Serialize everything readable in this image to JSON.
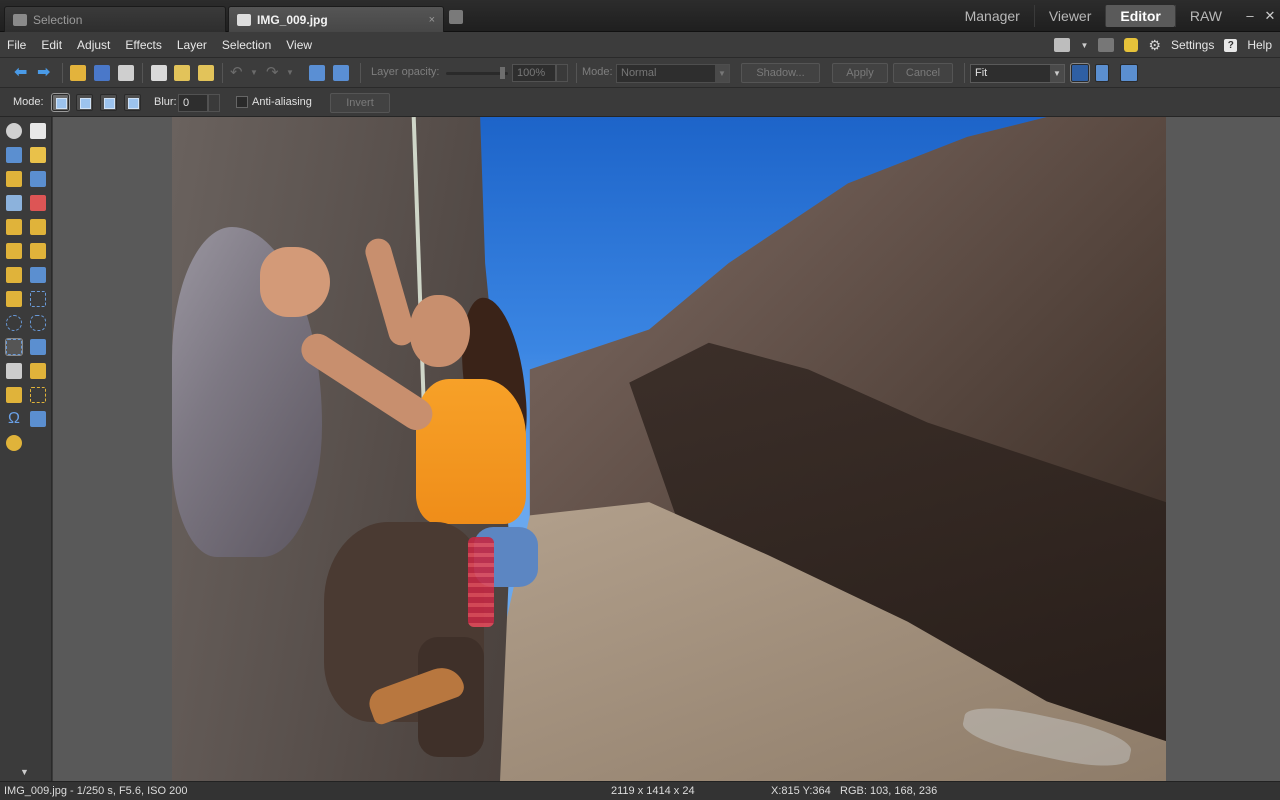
{
  "tabs": [
    {
      "label": "Selection",
      "icon": "folder-icon",
      "active": false
    },
    {
      "label": "IMG_009.jpg",
      "icon": "edit-icon",
      "active": true,
      "close": "×"
    }
  ],
  "modes": [
    {
      "label": "Manager",
      "active": false
    },
    {
      "label": "Viewer",
      "active": false
    },
    {
      "label": "Editor",
      "active": true
    },
    {
      "label": "RAW",
      "active": false
    }
  ],
  "window": {
    "minimize": "–",
    "close": "✕"
  },
  "menu": [
    {
      "label": "File",
      "key": "F"
    },
    {
      "label": "Edit",
      "key": "E"
    },
    {
      "label": "Adjust",
      "key": "A"
    },
    {
      "label": "Effects",
      "key": "E"
    },
    {
      "label": "Layer",
      "key": "L"
    },
    {
      "label": "Selection",
      "key": "S"
    },
    {
      "label": "View",
      "key": "V"
    }
  ],
  "menu_right": {
    "settings": "Settings",
    "help": "Help"
  },
  "toolbar": {
    "layer_opacity_label": "Layer opacity:",
    "layer_opacity_value": "100%",
    "mode_label": "Mode:",
    "mode_value": "Normal",
    "shadow_button": "Shadow...",
    "apply_button": "Apply",
    "cancel_button": "Cancel",
    "zoom_value": "Fit"
  },
  "selection_bar": {
    "mode_label": "Mode:",
    "blur_label": "Blur:",
    "blur_value": "0",
    "antialias_label": "Anti-aliasing",
    "invert_button": "Invert"
  },
  "status": {
    "file_info": "IMG_009.jpg - 1/250 s, F5.6, ISO 200",
    "dimensions": "2119 x 1414 x 24",
    "coords": "X:815 Y:364",
    "rgb": "RGB: 103, 168, 236"
  },
  "colors": {
    "accent_blue": "#4a9be8",
    "shirt_orange": "#f7a128",
    "sky_blue": "#3b86e3"
  }
}
